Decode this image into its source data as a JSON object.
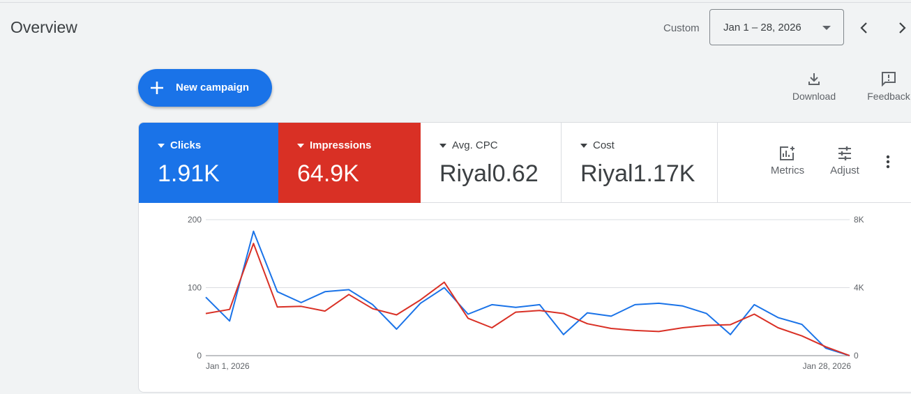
{
  "header": {
    "title": "Overview",
    "range_type": "Custom",
    "date_range": "Jan 1 – 28, 2026"
  },
  "actions": {
    "new_campaign": "New campaign",
    "download": "Download",
    "feedback": "Feedback"
  },
  "metrics": [
    {
      "name": "Clicks",
      "value": "1.91K",
      "color": "#1a73e8"
    },
    {
      "name": "Impressions",
      "value": "64.9K",
      "color": "#d93025"
    },
    {
      "name": "Avg. CPC",
      "value": "Riyal0.62"
    },
    {
      "name": "Cost",
      "value": "Riyal1.17K"
    }
  ],
  "metric_tools": {
    "metrics": "Metrics",
    "adjust": "Adjust"
  },
  "chart_data": {
    "type": "line",
    "x_labels": [
      "Jan 1, 2026",
      "Jan 28, 2026"
    ],
    "left_axis": {
      "ticks": [
        "0",
        "100",
        "200"
      ],
      "min": 0,
      "max": 200
    },
    "right_axis": {
      "ticks": [
        "0",
        "4K",
        "8K"
      ],
      "min": 0,
      "max": 8000
    },
    "grid": true,
    "series": [
      {
        "name": "Clicks",
        "axis": "left",
        "color": "#1a73e8",
        "values": [
          86,
          51,
          183,
          94,
          78,
          94,
          97,
          75,
          39,
          77,
          100,
          61,
          75,
          71,
          75,
          31,
          63,
          58,
          75,
          77,
          73,
          62,
          31,
          75,
          56,
          46,
          11,
          0
        ]
      },
      {
        "name": "Impressions",
        "axis": "right",
        "color": "#d93025",
        "values": [
          2480,
          2720,
          6600,
          2860,
          2900,
          2620,
          3600,
          2760,
          2400,
          3280,
          4320,
          2200,
          1640,
          2560,
          2660,
          2480,
          1880,
          1600,
          1480,
          1420,
          1640,
          1780,
          1820,
          2440,
          1640,
          1160,
          520,
          0
        ]
      }
    ]
  }
}
